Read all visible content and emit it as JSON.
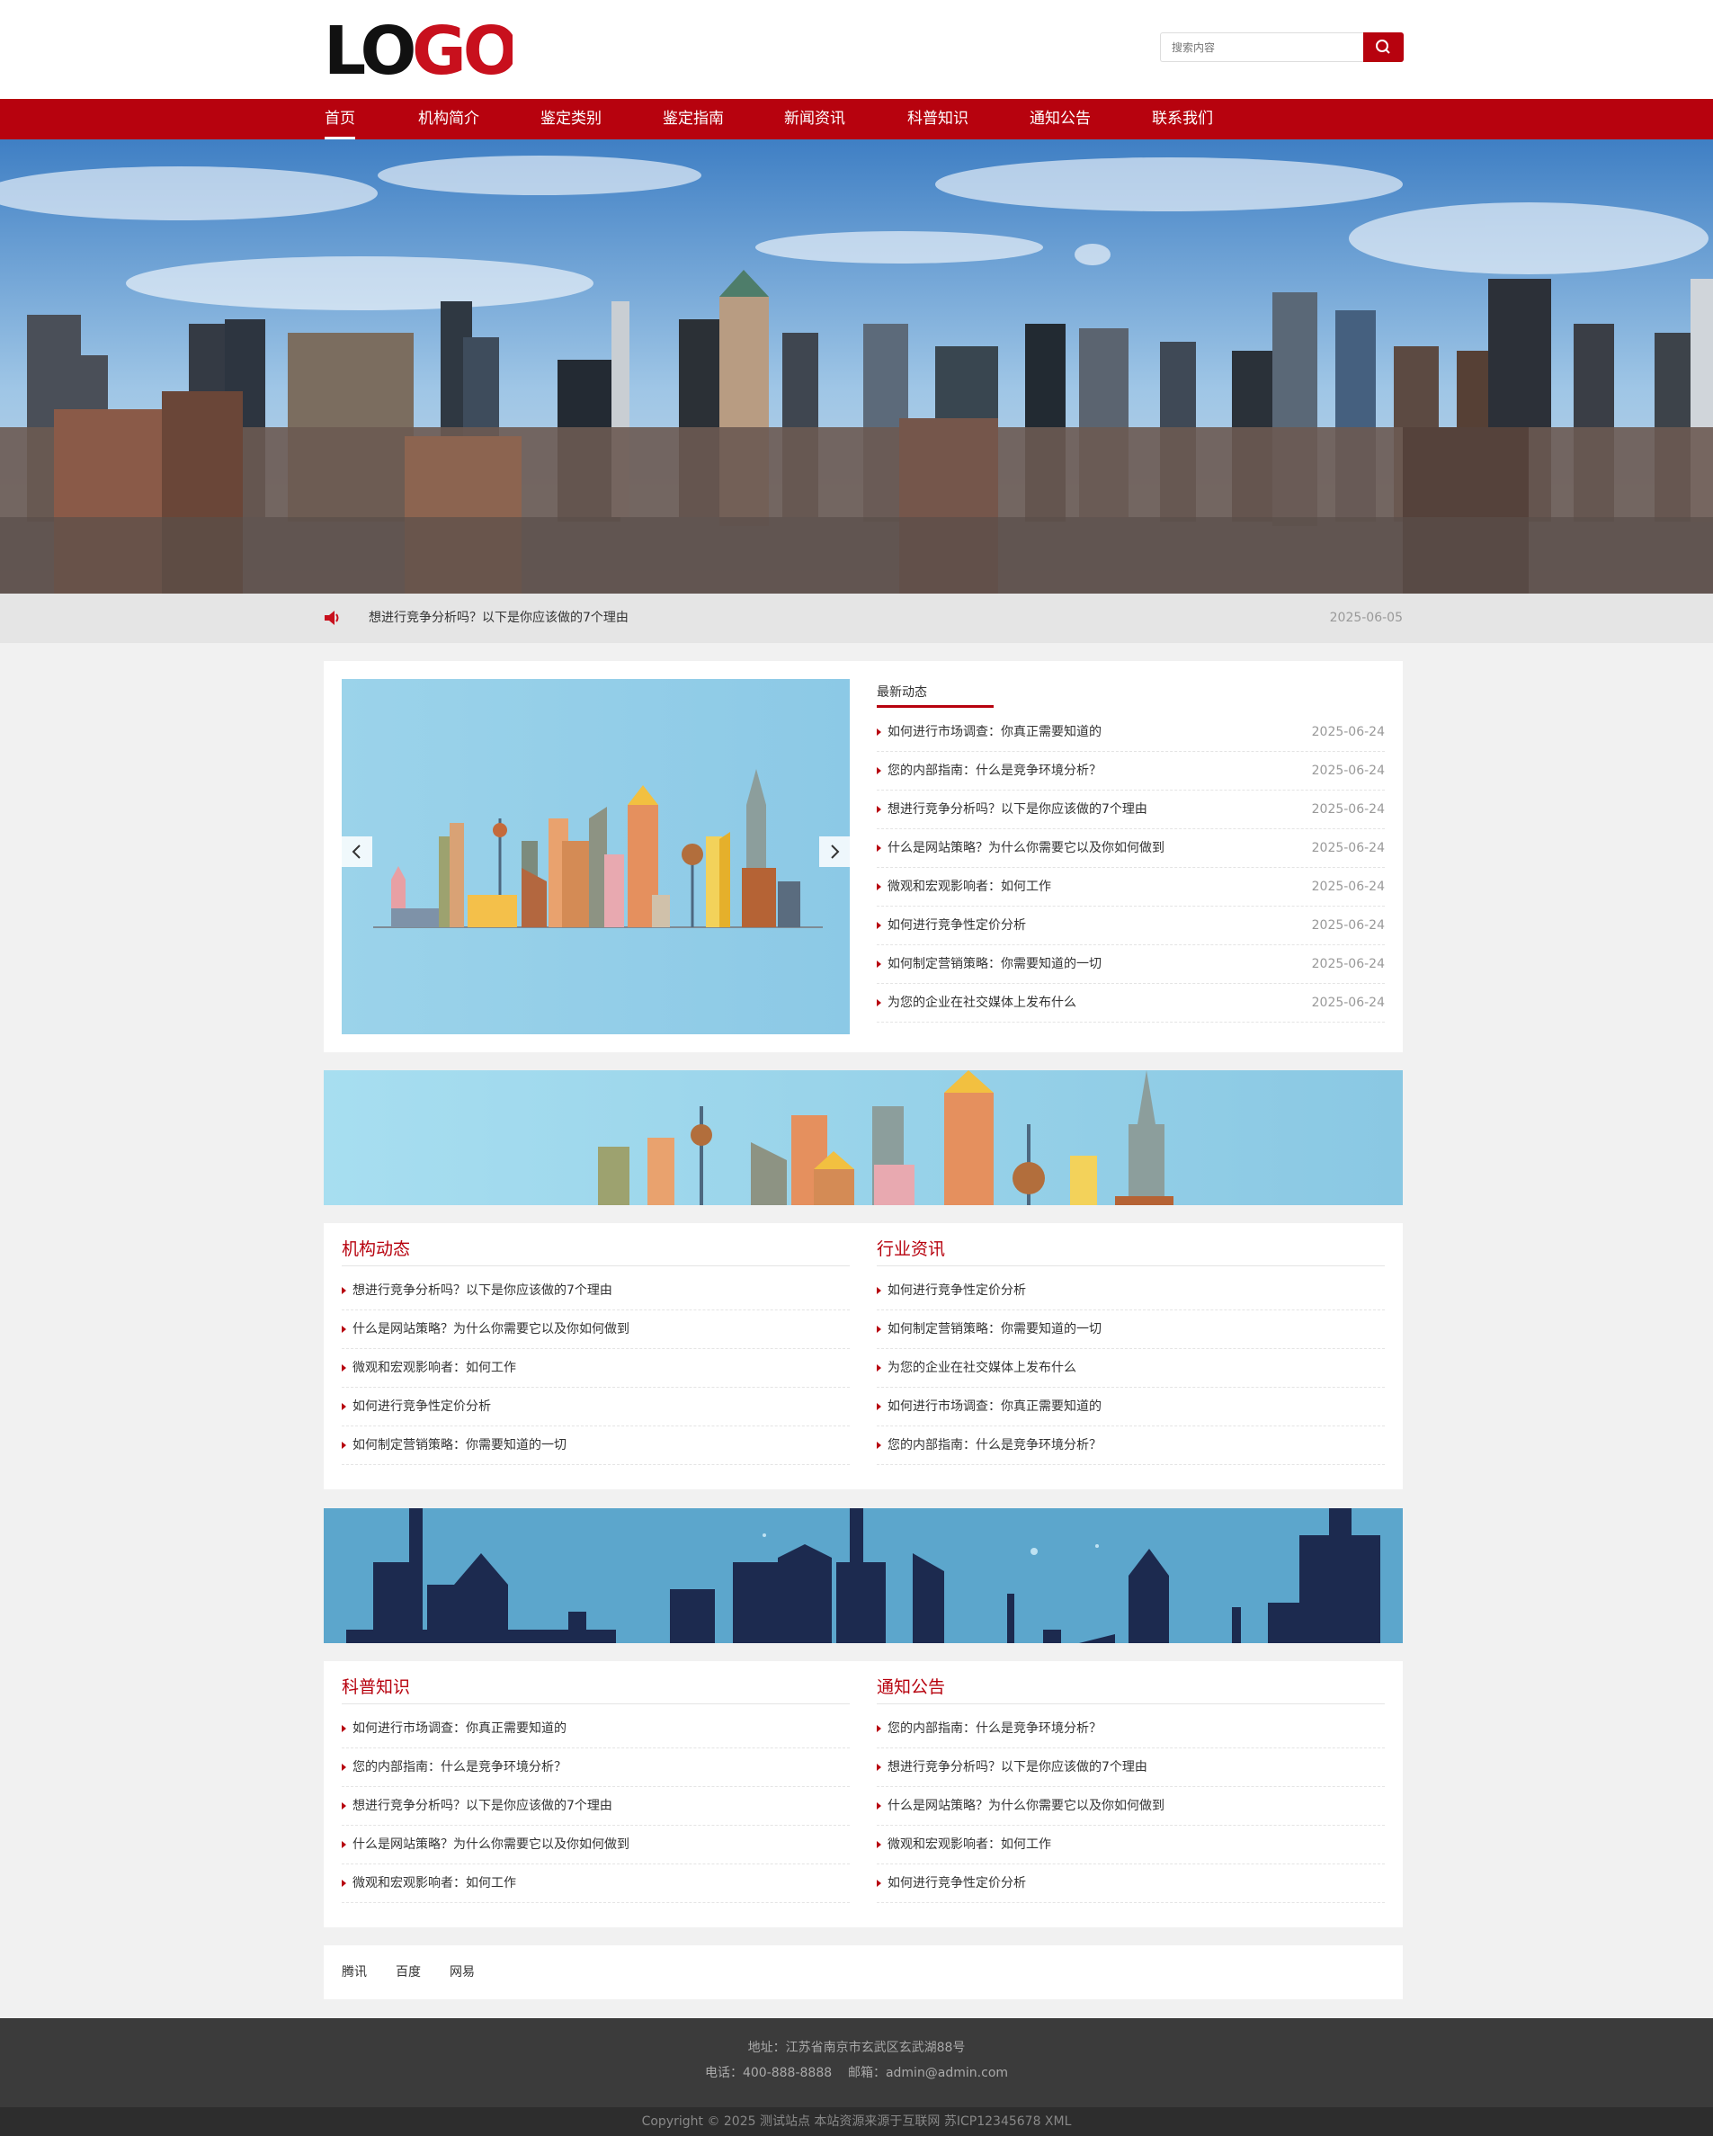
{
  "header": {
    "logo_text": "LOGO",
    "search_placeholder": "搜索内容"
  },
  "nav": {
    "items": [
      "首页",
      "机构简介",
      "鉴定类别",
      "鉴定指南",
      "新闻资讯",
      "科普知识",
      "通知公告",
      "联系我们"
    ],
    "active": "首页"
  },
  "banner": {
    "dot_count": 2,
    "active_dot": 1
  },
  "notice": {
    "text": "想进行竞争分析吗？以下是你应该做的7个理由",
    "date": "2025-06-05"
  },
  "latest": {
    "title": "最新动态",
    "items": [
      {
        "text": "如何进行市场调查：你真正需要知道的",
        "date": "2025-06-24"
      },
      {
        "text": "您的内部指南：什么是竞争环境分析？",
        "date": "2025-06-24"
      },
      {
        "text": "想进行竞争分析吗？以下是你应该做的7个理由",
        "date": "2025-06-24"
      },
      {
        "text": "什么是网站策略？为什么你需要它以及你如何做到",
        "date": "2025-06-24"
      },
      {
        "text": "微观和宏观影响者：如何工作",
        "date": "2025-06-24"
      },
      {
        "text": "如何进行竞争性定价分析",
        "date": "2025-06-24"
      },
      {
        "text": "如何制定营销策略：你需要知道的一切",
        "date": "2025-06-24"
      },
      {
        "text": "为您的企业在社交媒体上发布什么",
        "date": "2025-06-24"
      }
    ]
  },
  "sections": {
    "org_news": {
      "title": "机构动态",
      "items": [
        "想进行竞争分析吗？以下是你应该做的7个理由",
        "什么是网站策略？为什么你需要它以及你如何做到",
        "微观和宏观影响者：如何工作",
        "如何进行竞争性定价分析",
        "如何制定营销策略：你需要知道的一切"
      ]
    },
    "industry_news": {
      "title": "行业资讯",
      "items": [
        "如何进行竞争性定价分析",
        "如何制定营销策略：你需要知道的一切",
        "为您的企业在社交媒体上发布什么",
        "如何进行市场调查：你真正需要知道的",
        "您的内部指南：什么是竞争环境分析？"
      ]
    },
    "science": {
      "title": "科普知识",
      "items": [
        "如何进行市场调查：你真正需要知道的",
        "您的内部指南：什么是竞争环境分析？",
        "想进行竞争分析吗？以下是你应该做的7个理由",
        "什么是网站策略？为什么你需要它以及你如何做到",
        "微观和宏观影响者：如何工作"
      ]
    },
    "announcements": {
      "title": "通知公告",
      "items": [
        "您的内部指南：什么是竞争环境分析？",
        "想进行竞争分析吗？以下是你应该做的7个理由",
        "什么是网站策略？为什么你需要它以及你如何做到",
        "微观和宏观影响者：如何工作",
        "如何进行竞争性定价分析"
      ]
    }
  },
  "links": [
    "腾讯",
    "百度",
    "网易"
  ],
  "footer": {
    "address": "地址：江苏省南京市玄武区玄武湖88号",
    "contact": "电话：400-888-8888    邮箱：admin@admin.com",
    "copyright": "Copyright © 2025 测试站点 本站资源来源于互联网 苏ICP12345678 XML"
  },
  "colors": {
    "brand": "#b7020e",
    "footer": "#3b3b3b",
    "page_bg": "#f1f1f1"
  },
  "icons": [
    "search-icon",
    "speaker-icon",
    "chevron-left-icon",
    "chevron-right-icon"
  ]
}
